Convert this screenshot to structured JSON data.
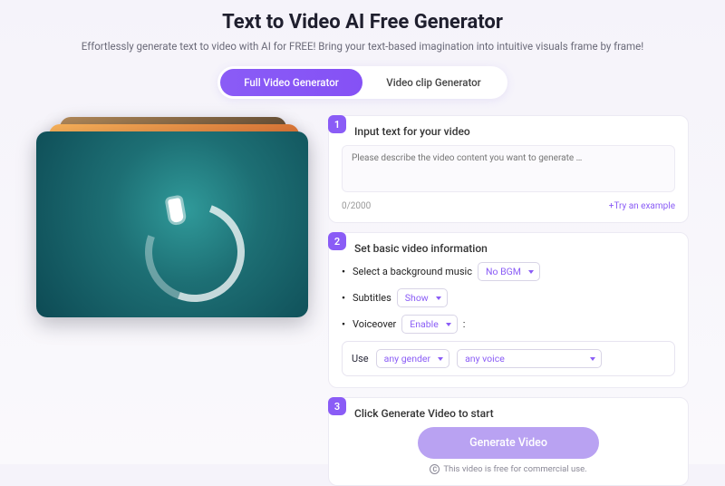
{
  "header": {
    "title": "Text to Video AI Free Generator",
    "subtitle": "Effortlessly generate text to video with AI for FREE! Bring your text-based imagination into intuitive visuals frame by frame!"
  },
  "tabs": {
    "full": "Full Video Generator",
    "clip": "Video clip Generator"
  },
  "step1": {
    "num": "1",
    "title": "Input text for your video",
    "placeholder": "Please describe the video content you want to generate …",
    "counter": "0/2000",
    "try_link": "+Try an example"
  },
  "step2": {
    "num": "2",
    "title": "Set basic video information",
    "bgm_label": "Select a background music",
    "bgm_value": "No BGM",
    "subtitles_label": "Subtitles",
    "subtitles_value": "Show",
    "voiceover_label": "Voiceover",
    "voiceover_value": "Enable",
    "colon": ":",
    "use_label": "Use",
    "gender_value": "any gender",
    "voice_value": "any voice"
  },
  "step3": {
    "num": "3",
    "title": "Click Generate Video to start",
    "button": "Generate Video",
    "commercial": "This video is free for commercial use.",
    "cc_glyph": "C"
  }
}
